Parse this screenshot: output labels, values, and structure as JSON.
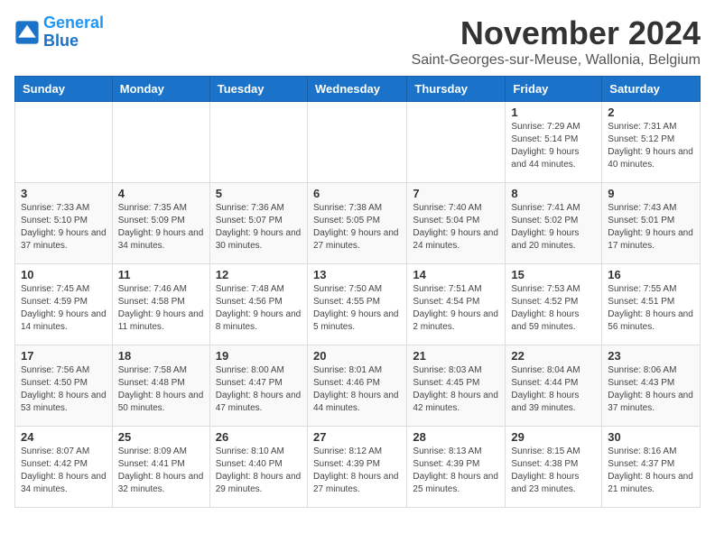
{
  "logo": {
    "line1": "General",
    "line2": "Blue"
  },
  "title": "November 2024",
  "location": "Saint-Georges-sur-Meuse, Wallonia, Belgium",
  "weekdays": [
    "Sunday",
    "Monday",
    "Tuesday",
    "Wednesday",
    "Thursday",
    "Friday",
    "Saturday"
  ],
  "weeks": [
    [
      {
        "day": "",
        "info": ""
      },
      {
        "day": "",
        "info": ""
      },
      {
        "day": "",
        "info": ""
      },
      {
        "day": "",
        "info": ""
      },
      {
        "day": "",
        "info": ""
      },
      {
        "day": "1",
        "info": "Sunrise: 7:29 AM\nSunset: 5:14 PM\nDaylight: 9 hours and 44 minutes."
      },
      {
        "day": "2",
        "info": "Sunrise: 7:31 AM\nSunset: 5:12 PM\nDaylight: 9 hours and 40 minutes."
      }
    ],
    [
      {
        "day": "3",
        "info": "Sunrise: 7:33 AM\nSunset: 5:10 PM\nDaylight: 9 hours and 37 minutes."
      },
      {
        "day": "4",
        "info": "Sunrise: 7:35 AM\nSunset: 5:09 PM\nDaylight: 9 hours and 34 minutes."
      },
      {
        "day": "5",
        "info": "Sunrise: 7:36 AM\nSunset: 5:07 PM\nDaylight: 9 hours and 30 minutes."
      },
      {
        "day": "6",
        "info": "Sunrise: 7:38 AM\nSunset: 5:05 PM\nDaylight: 9 hours and 27 minutes."
      },
      {
        "day": "7",
        "info": "Sunrise: 7:40 AM\nSunset: 5:04 PM\nDaylight: 9 hours and 24 minutes."
      },
      {
        "day": "8",
        "info": "Sunrise: 7:41 AM\nSunset: 5:02 PM\nDaylight: 9 hours and 20 minutes."
      },
      {
        "day": "9",
        "info": "Sunrise: 7:43 AM\nSunset: 5:01 PM\nDaylight: 9 hours and 17 minutes."
      }
    ],
    [
      {
        "day": "10",
        "info": "Sunrise: 7:45 AM\nSunset: 4:59 PM\nDaylight: 9 hours and 14 minutes."
      },
      {
        "day": "11",
        "info": "Sunrise: 7:46 AM\nSunset: 4:58 PM\nDaylight: 9 hours and 11 minutes."
      },
      {
        "day": "12",
        "info": "Sunrise: 7:48 AM\nSunset: 4:56 PM\nDaylight: 9 hours and 8 minutes."
      },
      {
        "day": "13",
        "info": "Sunrise: 7:50 AM\nSunset: 4:55 PM\nDaylight: 9 hours and 5 minutes."
      },
      {
        "day": "14",
        "info": "Sunrise: 7:51 AM\nSunset: 4:54 PM\nDaylight: 9 hours and 2 minutes."
      },
      {
        "day": "15",
        "info": "Sunrise: 7:53 AM\nSunset: 4:52 PM\nDaylight: 8 hours and 59 minutes."
      },
      {
        "day": "16",
        "info": "Sunrise: 7:55 AM\nSunset: 4:51 PM\nDaylight: 8 hours and 56 minutes."
      }
    ],
    [
      {
        "day": "17",
        "info": "Sunrise: 7:56 AM\nSunset: 4:50 PM\nDaylight: 8 hours and 53 minutes."
      },
      {
        "day": "18",
        "info": "Sunrise: 7:58 AM\nSunset: 4:48 PM\nDaylight: 8 hours and 50 minutes."
      },
      {
        "day": "19",
        "info": "Sunrise: 8:00 AM\nSunset: 4:47 PM\nDaylight: 8 hours and 47 minutes."
      },
      {
        "day": "20",
        "info": "Sunrise: 8:01 AM\nSunset: 4:46 PM\nDaylight: 8 hours and 44 minutes."
      },
      {
        "day": "21",
        "info": "Sunrise: 8:03 AM\nSunset: 4:45 PM\nDaylight: 8 hours and 42 minutes."
      },
      {
        "day": "22",
        "info": "Sunrise: 8:04 AM\nSunset: 4:44 PM\nDaylight: 8 hours and 39 minutes."
      },
      {
        "day": "23",
        "info": "Sunrise: 8:06 AM\nSunset: 4:43 PM\nDaylight: 8 hours and 37 minutes."
      }
    ],
    [
      {
        "day": "24",
        "info": "Sunrise: 8:07 AM\nSunset: 4:42 PM\nDaylight: 8 hours and 34 minutes."
      },
      {
        "day": "25",
        "info": "Sunrise: 8:09 AM\nSunset: 4:41 PM\nDaylight: 8 hours and 32 minutes."
      },
      {
        "day": "26",
        "info": "Sunrise: 8:10 AM\nSunset: 4:40 PM\nDaylight: 8 hours and 29 minutes."
      },
      {
        "day": "27",
        "info": "Sunrise: 8:12 AM\nSunset: 4:39 PM\nDaylight: 8 hours and 27 minutes."
      },
      {
        "day": "28",
        "info": "Sunrise: 8:13 AM\nSunset: 4:39 PM\nDaylight: 8 hours and 25 minutes."
      },
      {
        "day": "29",
        "info": "Sunrise: 8:15 AM\nSunset: 4:38 PM\nDaylight: 8 hours and 23 minutes."
      },
      {
        "day": "30",
        "info": "Sunrise: 8:16 AM\nSunset: 4:37 PM\nDaylight: 8 hours and 21 minutes."
      }
    ]
  ]
}
